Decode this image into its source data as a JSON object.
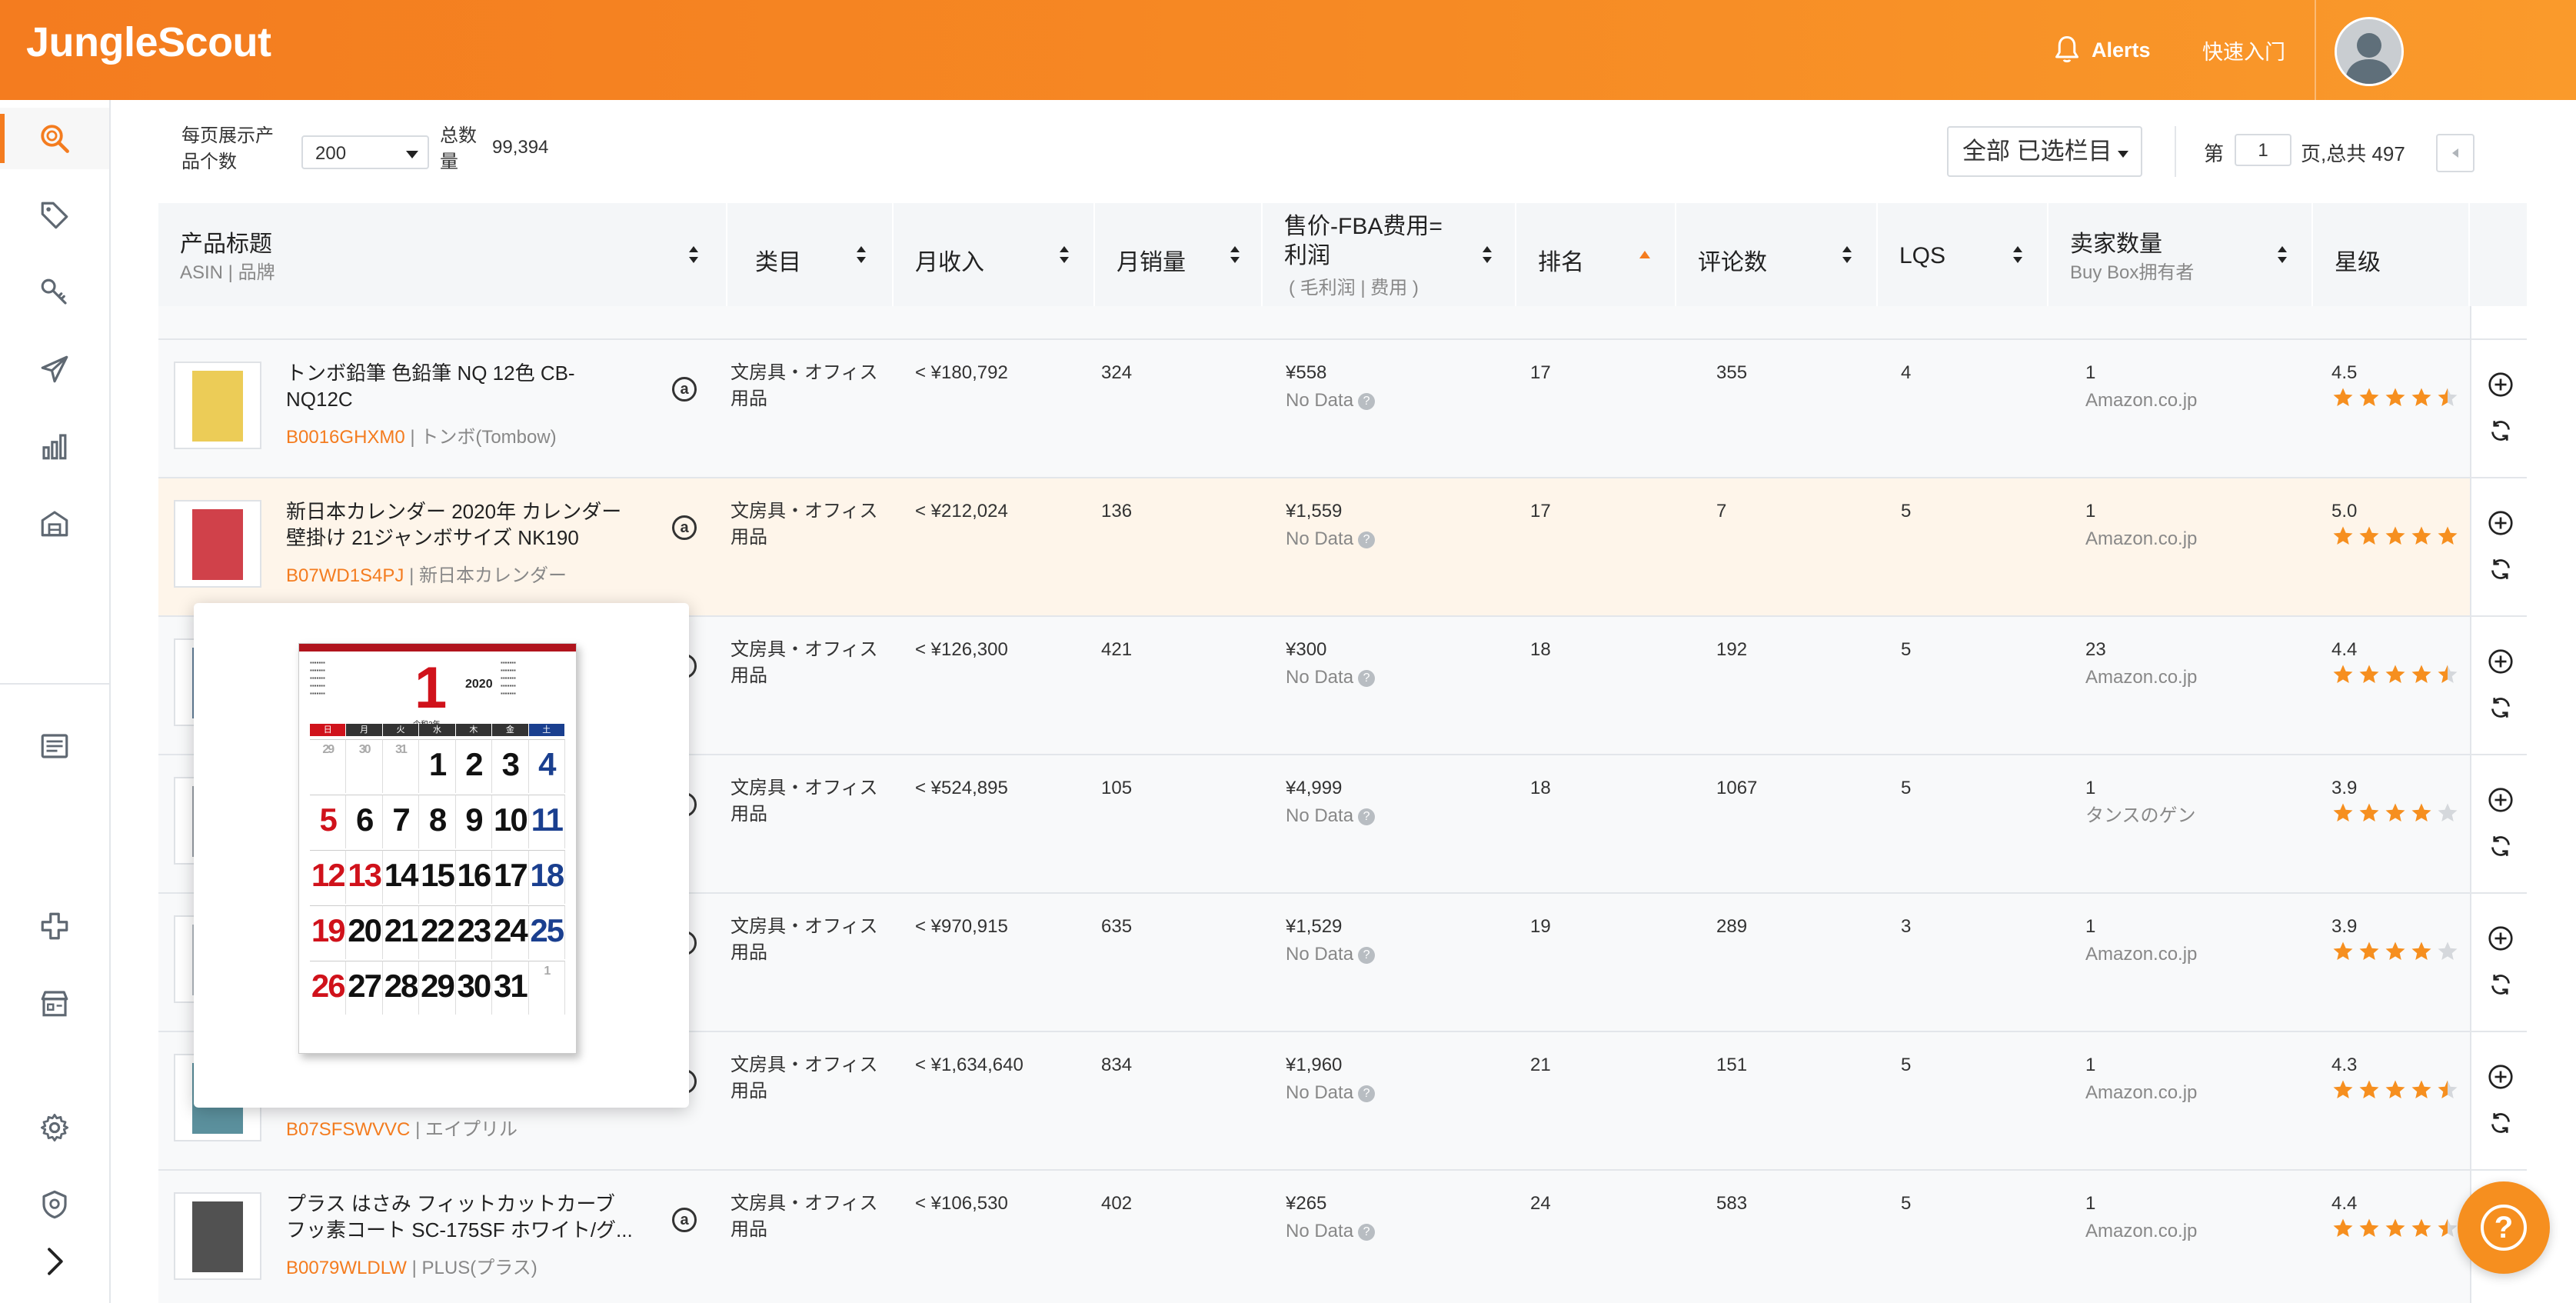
{
  "app": {
    "logo": "JungleScout"
  },
  "header": {
    "alerts_label": "Alerts",
    "quickstart_label": "快速入门"
  },
  "sidebar": {
    "items": [
      {
        "name": "search-icon"
      },
      {
        "name": "tag-icon"
      },
      {
        "name": "key-icon"
      },
      {
        "name": "paper-plane-icon"
      },
      {
        "name": "bar-chart-icon"
      },
      {
        "name": "warehouse-icon"
      },
      {
        "name": "news-icon"
      },
      {
        "name": "puzzle-icon"
      },
      {
        "name": "store-icon"
      },
      {
        "name": "gear-icon"
      },
      {
        "name": "shield-icon"
      },
      {
        "name": "chevron-right-icon"
      }
    ]
  },
  "toolbar": {
    "per_page_label": "每页展示产品个数",
    "per_page_value": "200",
    "total_label": "总数量",
    "total_value": "99,394",
    "columns_button": "全部 已选栏目",
    "page_prefix": "第",
    "page_value": "1",
    "page_total": "页,总共 497"
  },
  "table": {
    "headers": {
      "title": "产品标题",
      "title_sub": "ASIN | 品牌",
      "category": "类目",
      "revenue": "月收入",
      "sales": "月销量",
      "profit": "售价-FBA费用=利润",
      "profit_sub": "( 毛利润 | 费用 )",
      "rank": "排名",
      "reviews": "评论数",
      "lqs": "LQS",
      "sellers": "卖家数量",
      "sellers_sub": "Buy Box拥有者",
      "rating": "星级"
    },
    "rows": [
      {
        "title": "トンボ鉛筆 色鉛筆 NQ 12色 CB-NQ12C",
        "asin": "B0016GHXM0",
        "brand": "| トンボ(Tombow)",
        "category": "文房具・オフィス用品",
        "revenue": "< ¥180,792",
        "sales": "324",
        "price": "¥558",
        "profit_sub": "No Data",
        "rank": "17",
        "reviews": "355",
        "lqs": "4",
        "sellers": "1",
        "buybox": "Amazon.co.jp",
        "rating": "4.5",
        "stars": 4.5
      },
      {
        "title": "新日本カレンダー 2020年 カレンダー 壁掛け 21ジャンボサイズ NK190",
        "asin": "B07WD1S4PJ",
        "brand": "| 新日本カレンダー",
        "category": "文房具・オフィス用品",
        "revenue": "< ¥212,024",
        "sales": "136",
        "price": "¥1,559",
        "profit_sub": "No Data",
        "rank": "17",
        "reviews": "7",
        "lqs": "5",
        "sellers": "1",
        "buybox": "Amazon.co.jp",
        "rating": "5.0",
        "stars": 5
      },
      {
        "title": "",
        "asin": "",
        "brand": "",
        "category": "文房具・オフィス用品",
        "revenue": "< ¥126,300",
        "sales": "421",
        "price": "¥300",
        "profit_sub": "No Data",
        "rank": "18",
        "reviews": "192",
        "lqs": "5",
        "sellers": "23",
        "buybox": "Amazon.co.jp",
        "rating": "4.4",
        "stars": 4.5
      },
      {
        "title": "",
        "asin": "",
        "brand": "",
        "category": "文房具・オフィス用品",
        "revenue": "< ¥524,895",
        "sales": "105",
        "price": "¥4,999",
        "profit_sub": "No Data",
        "rank": "18",
        "reviews": "1067",
        "lqs": "5",
        "sellers": "1",
        "buybox": "タンスのゲン",
        "rating": "3.9",
        "stars": 4
      },
      {
        "title": "",
        "asin": "",
        "brand": "",
        "category": "文房具・オフィス用品",
        "revenue": "< ¥970,915",
        "sales": "635",
        "price": "¥1,529",
        "profit_sub": "No Data",
        "rank": "19",
        "reviews": "289",
        "lqs": "3",
        "sellers": "1",
        "buybox": "Amazon.co.jp",
        "rating": "3.9",
        "stars": 4
      },
      {
        "title": "",
        "asin": "B07SFSWVVC",
        "brand": "| エイプリル",
        "category": "文房具・オフィス用品",
        "revenue": "< ¥1,634,640",
        "sales": "834",
        "price": "¥1,960",
        "profit_sub": "No Data",
        "rank": "21",
        "reviews": "151",
        "lqs": "5",
        "sellers": "1",
        "buybox": "Amazon.co.jp",
        "rating": "4.3",
        "stars": 4.5
      },
      {
        "title": "プラス はさみ フィットカットカーブ フッ素コート SC-175SF ホワイト/グ...",
        "asin": "B0079WLDLW",
        "brand": "| PLUS(プラス)",
        "category": "文房具・オフィス用品",
        "revenue": "< ¥106,530",
        "sales": "402",
        "price": "¥265",
        "profit_sub": "No Data",
        "rank": "24",
        "reviews": "583",
        "lqs": "5",
        "sellers": "1",
        "buybox": "Amazon.co.jp",
        "rating": "4.4",
        "stars": 4.5
      }
    ]
  },
  "popover": {
    "calendar": {
      "month": "1",
      "year": "2020",
      "era": "令和2年",
      "weekdays": [
        "日",
        "月",
        "火",
        "水",
        "木",
        "金",
        "土"
      ],
      "weeks": [
        [
          "29",
          "30",
          "31",
          "1",
          "2",
          "3",
          "4"
        ],
        [
          "5",
          "6",
          "7",
          "8",
          "9",
          "10",
          "11"
        ],
        [
          "12",
          "13",
          "14",
          "15",
          "16",
          "17",
          "18"
        ],
        [
          "19",
          "20",
          "21",
          "22",
          "23",
          "24",
          "25"
        ],
        [
          "26",
          "27",
          "28",
          "29",
          "30",
          "31",
          "1"
        ]
      ]
    }
  },
  "help_fab": {
    "label": "?"
  },
  "colors": {
    "accent": "#f47c1f",
    "star": "#f68f1f",
    "highlight_row": "#fef5ea",
    "asin": "#f47c1f"
  }
}
